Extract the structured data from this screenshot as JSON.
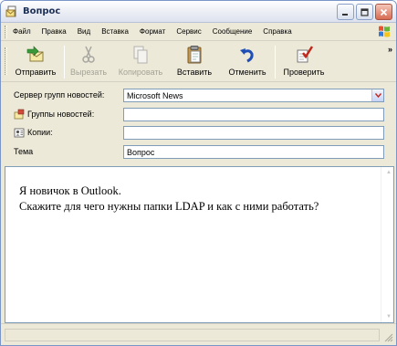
{
  "window": {
    "title": "Вопрос",
    "controls": {
      "minimize": "_",
      "maximize": "□",
      "close": "✕"
    }
  },
  "menu": {
    "items": [
      "Файл",
      "Правка",
      "Вид",
      "Вставка",
      "Формат",
      "Сервис",
      "Сообщение",
      "Справка"
    ]
  },
  "toolbar": {
    "send": "Отправить",
    "cut": "Вырезать",
    "copy": "Копировать",
    "paste": "Вставить",
    "undo": "Отменить",
    "check": "Проверить",
    "more": "»"
  },
  "fields": {
    "server_label": "Сервер групп новостей:",
    "server_value": "Microsoft News",
    "groups_label": "Группы новостей:",
    "groups_value": "",
    "cc_label": "Копии:",
    "cc_value": "",
    "subject_label": "Тема",
    "subject_value": "Вопрос"
  },
  "message": {
    "line1": "Я новичок в Outlook.",
    "line2": "Скажите для чего нужны папки LDAP и как с ними работать?"
  },
  "colors": {
    "window_bg": "#ece9d8",
    "frame": "#7a96c8",
    "field_border": "#7f9db9",
    "disabled_text": "#a5a396"
  },
  "icons": {
    "title": "envelope-icon",
    "send": "send-icon",
    "cut": "scissors-icon",
    "copy": "copy-icon",
    "paste": "clipboard-icon",
    "undo": "undo-arrow-icon",
    "check": "spellcheck-icon",
    "groups": "newsgroups-icon",
    "cc": "address-book-icon",
    "logo": "windows-flag-icon"
  }
}
